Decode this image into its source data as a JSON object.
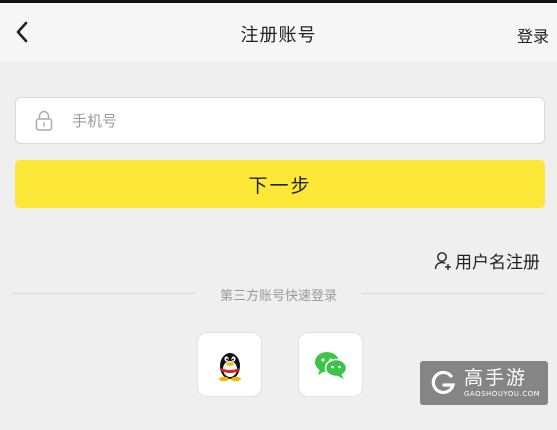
{
  "header": {
    "title": "注册账号",
    "login_label": "登录",
    "back_icon": "chevron-left-icon"
  },
  "form": {
    "phone_placeholder": "手机号",
    "phone_value": "",
    "lock_icon": "lock-icon",
    "next_label": "下一步",
    "username_register_label": "用户名注册",
    "username_icon": "user-add-icon"
  },
  "third_party": {
    "divider_label": "第三方账号快速登录",
    "providers": [
      "qq-icon",
      "wechat-icon"
    ]
  },
  "watermark": {
    "main": "高手游",
    "sub": "GAOSHOUYOU.COM"
  },
  "colors": {
    "accent": "#fde838",
    "background": "#efefef",
    "wechat": "#3bc447"
  }
}
